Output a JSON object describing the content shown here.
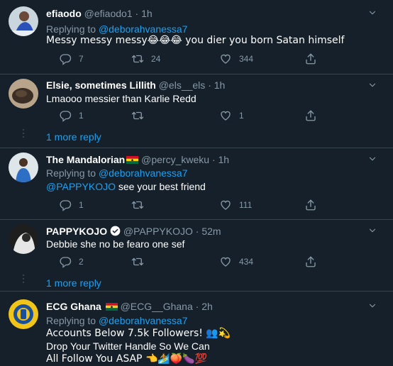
{
  "tweets": [
    {
      "name": "efiaodo",
      "handle": "@efiaodo1",
      "dot": "·",
      "time": "1h",
      "replying_prefix": "Replying to",
      "replying_to": "@deborahvanessa7",
      "text": "Messy messy messy😂😂😂 you dier you born Satan himself",
      "reply_count": "7",
      "retweet_count": "24",
      "like_count": "344"
    },
    {
      "name": "Elsie, sometimes Lillith",
      "handle": "@els__els",
      "dot": "·",
      "time": "1h",
      "text": "Lmaooo messier than Karlie Redd",
      "reply_count": "1",
      "retweet_count": "",
      "like_count": "1"
    },
    {
      "name": "The Mandalorian",
      "handle": "@percy_kweku",
      "dot": "·",
      "time": "1h",
      "replying_prefix": "Replying to",
      "replying_to": "@deborahvanessa7",
      "text_mention": "@PAPPYKOJO",
      "text": " see your best friend",
      "reply_count": "1",
      "retweet_count": "",
      "like_count": "111"
    },
    {
      "name": "PAPPYKOJO",
      "handle": "@PAPPYKOJO",
      "dot": "·",
      "time": "52m",
      "text": "Debbie she no be fearo one sef",
      "reply_count": "2",
      "retweet_count": "",
      "like_count": "434"
    },
    {
      "name": "ECG Ghana",
      "handle": "@ECG__Ghana",
      "dot": "·",
      "time": "2h",
      "replying_prefix": "Replying to",
      "replying_to": "@deborahvanessa7",
      "text_line1": "Accounts Below 7.5k Followers! 👥💫",
      "text_line2": "Drop Your Twitter Handle So We Can",
      "text_line3": "All Follow You ASAP 👈🏄🍑🍆💯"
    }
  ],
  "more_replies_label": "1 more reply",
  "icons": [
    "reply-icon",
    "retweet-icon",
    "like-icon",
    "share-icon",
    "chevron-down-icon",
    "verified-icon",
    "ghana-flag-icon"
  ],
  "colors": {
    "background": "#15202b",
    "accent": "#1da1f2",
    "secondary_text": "#8899a6",
    "border": "#38444d"
  }
}
